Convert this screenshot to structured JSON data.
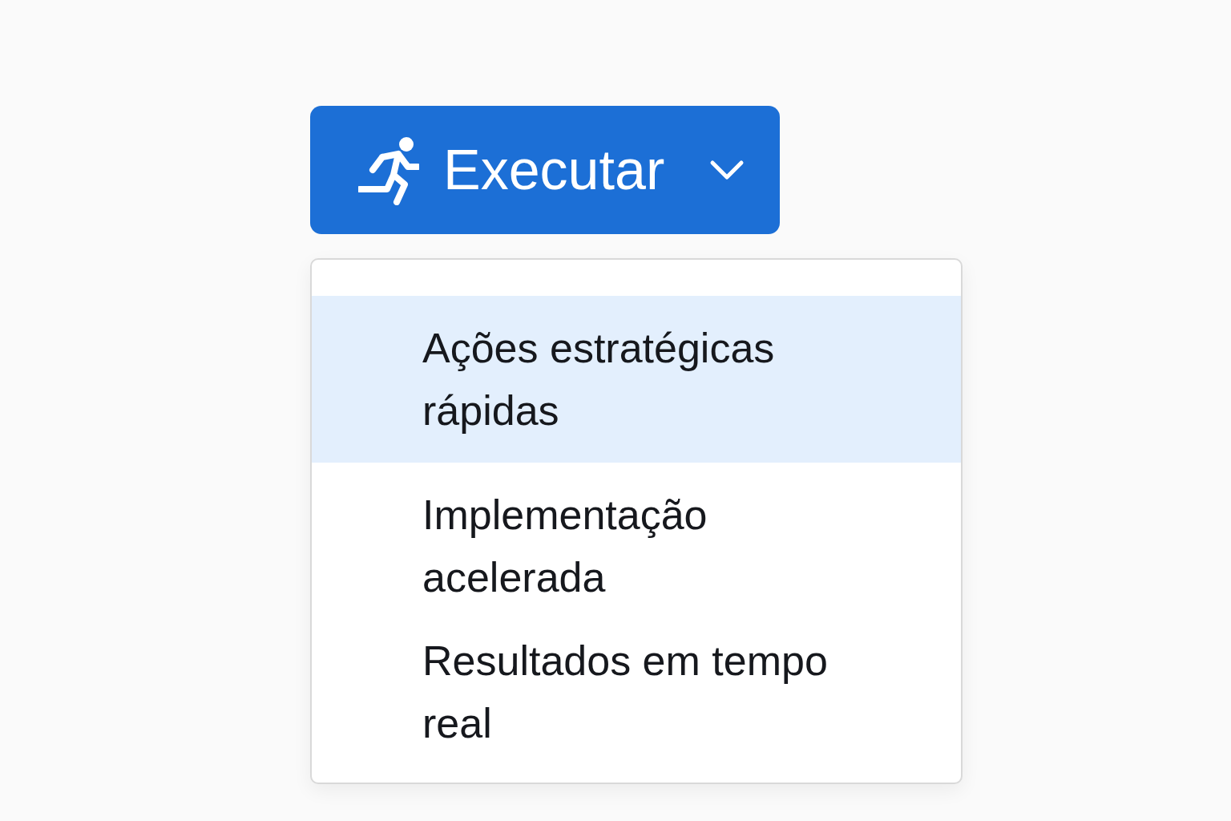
{
  "button": {
    "label": "Executar"
  },
  "menu": {
    "items": [
      {
        "label": "Ações estratégicas rápidas",
        "selected": true
      },
      {
        "label": "Implementação acelerada",
        "selected": false
      },
      {
        "label": "Resultados em tempo real",
        "selected": false
      }
    ]
  }
}
